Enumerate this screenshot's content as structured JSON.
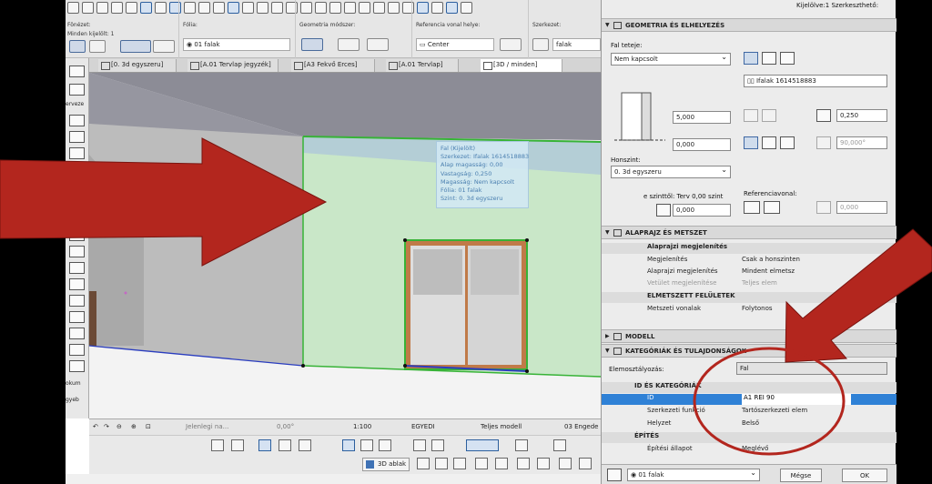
{
  "toolbar": {
    "fonezet_label": "Fönézet:",
    "minden_kijelolt": "Minden kijelölt: 1",
    "folia_label": "Fólia:",
    "folia_value": "01 falak",
    "geom_label": "Geometria módszer:",
    "ref_label": "Referencia vonal helye:",
    "ref_value": "Center",
    "szerkezet_label": "Szerkezet:",
    "szerkezet_value": "falak"
  },
  "tabs": [
    {
      "label": "[0. 3d egyszeru]"
    },
    {
      "label": "[A.01 Tervlap jegyzék]"
    },
    {
      "label": "[A3 Fekvő Erces]"
    },
    {
      "label": "[A.01 Tervlap]"
    },
    {
      "label": "[3D / minden]"
    }
  ],
  "palette": {
    "label_top": "erveze",
    "label_dokum": "okum",
    "label_egyeb": "gyeb"
  },
  "tooltip": {
    "lines": [
      "Fal (Kijelölt)",
      "Szerkezet: Ifalak 1614518883",
      "Alap magasság: 0,00",
      "Vastagság: 0,250",
      "Magasság: Nem kapcsolt",
      "Fólia: 01 falak",
      "Szint: 0. 3d egyszeru"
    ]
  },
  "status": {
    "jelenlegi": "Jelenlegi na...",
    "angle": "0,00°",
    "scale": "1:100",
    "egyedi": "EGYEDI",
    "model": "Teljes modell",
    "engedely": "03 Engede"
  },
  "bottom": {
    "btn_3d": "3D ablak"
  },
  "panel": {
    "header_right": "Kijelölve:1 Szerkeszthető:",
    "sec_geom": "GEOMETRIA ÉS ELHELYEZÉS",
    "fal_teteje_label": "Fal teteje:",
    "fal_teteje_value": "Nem kapcsolt",
    "structure_value": "Ifalak 1614518883",
    "height_value": "5,000",
    "offset_value": "0,000",
    "thickness_value": "0,250",
    "angle_value": "90,000°",
    "honszint_label": "Honszint:",
    "honszint_value": "0. 3d egyszeru",
    "szinttol_label": "e szinttől: Terv 0,00 szint",
    "szinttol_value": "0,000",
    "ref_line_label": "Referenciavonal:",
    "ref_line_value": "0,000",
    "sec_alap": "ALAPRAJZ ÉS METSZET",
    "alap_megj": "Alaprajzi megjelenítés",
    "row_megj_k": "Megjelenítés",
    "row_megj_v": "Csak a honszinten",
    "row_alapmegj_k": "Alaprajzi megjelenítés",
    "row_alapmegj_v": "Mindent elmetsz",
    "row_vetulet_k": "Vetület megjelenítése",
    "row_vetulet_v": "Teljes elem",
    "elmetszett": "ELMETSZETT FELÜLETEK",
    "row_metsz_k": "Metszeti vonalak",
    "row_metsz_v": "Folytonos",
    "sec_modell": "MODELL",
    "sec_kat": "KATEGÓRIÁK ÉS TULAJDONSÁGOK",
    "elemosztaly_label": "Elemosztályozás:",
    "elemosztaly_value": "Fal",
    "id_kat": "ID ÉS KATEGÓRIÁK",
    "row_id_k": "ID",
    "row_id_v": "A1 REI 90",
    "row_szerk_k": "Szerkezeti funkció",
    "row_szerk_v": "Tartószerkezeti elem",
    "row_helyzet_k": "Helyzet",
    "row_helyzet_v": "Belső",
    "epites": "ÉPÍTÉS",
    "row_epitesi_k": "Építési állapot",
    "row_epitesi_v": "Meglévő",
    "bottom_folia": "01 falak",
    "megse": "Mégse",
    "ok": "OK"
  },
  "colors": {
    "selection": "#2f81d6",
    "wall_highlight": "#3fbf3f",
    "annotation": "#b3261e"
  }
}
